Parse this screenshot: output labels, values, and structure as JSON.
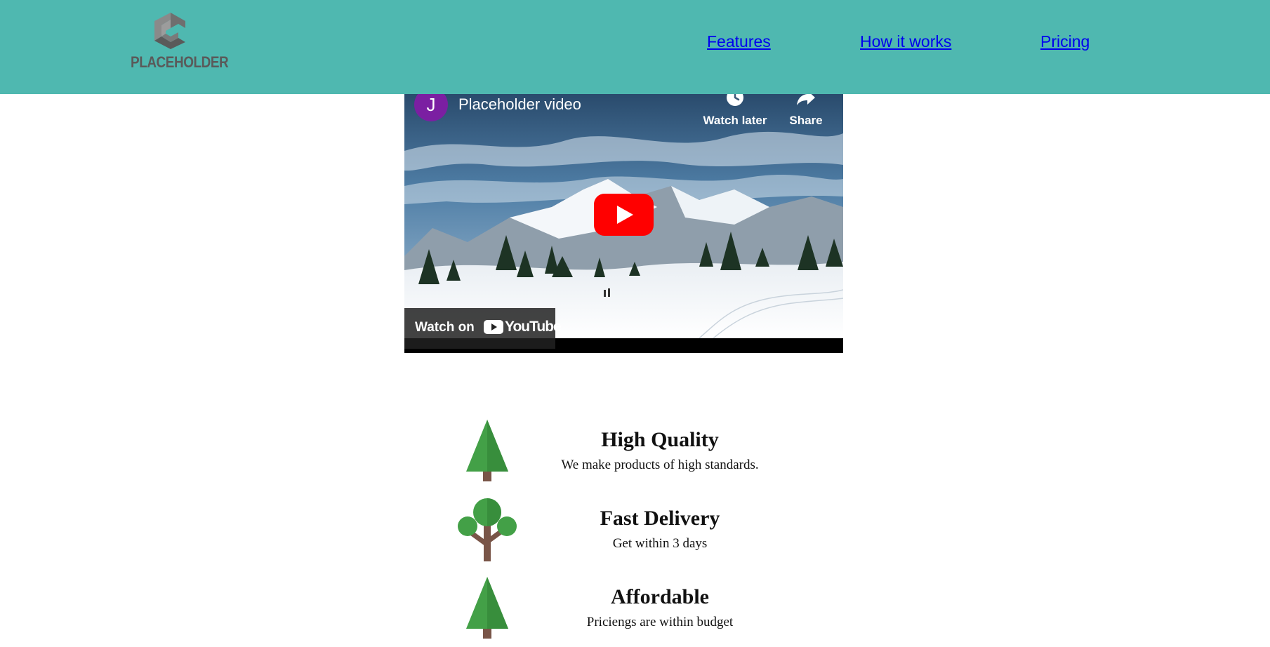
{
  "header": {
    "logo_text": "PLACEHOLDER",
    "nav": [
      "Features",
      "How it works",
      "Pricing"
    ],
    "background_color": "#4fb8b0",
    "link_color": "#0000ee"
  },
  "video": {
    "channel_initial": "J",
    "title": "Placeholder video",
    "watch_later_label": "Watch later",
    "share_label": "Share",
    "watch_on_label": "Watch on",
    "youtube_label": "YouTube",
    "avatar_color": "#7b1fa2",
    "play_color": "#ff0000"
  },
  "features": [
    {
      "icon": "pine-tree-icon",
      "title": "High Quality",
      "desc": "We make products of high standards."
    },
    {
      "icon": "round-tree-icon",
      "title": "Fast Delivery",
      "desc": "Get within 3 days"
    },
    {
      "icon": "pine-tree-icon",
      "title": "Affordable",
      "desc": "Priciengs are within budget"
    }
  ]
}
